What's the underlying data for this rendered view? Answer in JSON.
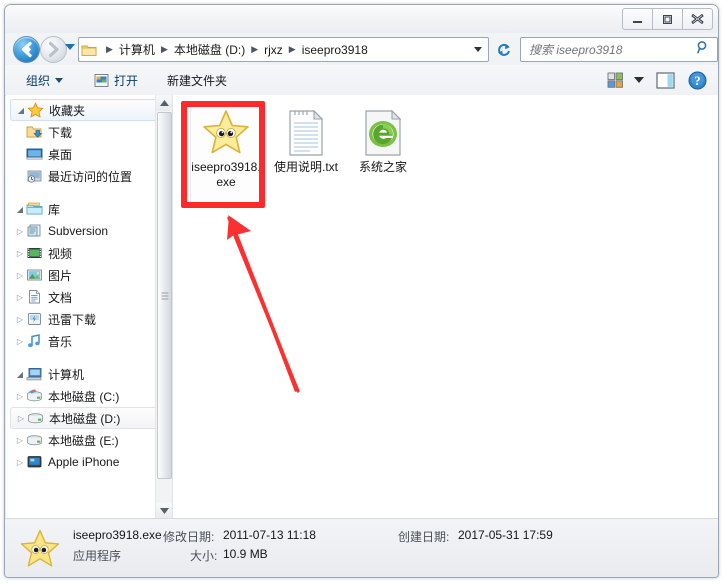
{
  "window": {
    "controls": {
      "minimize": "minimize-button",
      "maximize": "maximize-button",
      "close": "close-button"
    }
  },
  "address": {
    "back_tooltip": "后退",
    "forward_tooltip": "前进",
    "crumbs": [
      "计算机",
      "本地磁盘 (D:)",
      "rjxz",
      "iseepro3918"
    ],
    "separator": "▸"
  },
  "search": {
    "placeholder": "搜索 iseepro3918",
    "value": ""
  },
  "toolbar": {
    "organize": "组织",
    "open": "打开",
    "new_folder": "新建文件夹"
  },
  "sidebar": {
    "groups": [
      {
        "title": "收藏夹",
        "icon": "star-icon",
        "expanded": true,
        "items": [
          {
            "label": "下载",
            "icon": "download-folder-icon",
            "twisty": false
          },
          {
            "label": "桌面",
            "icon": "desktop-icon",
            "twisty": false
          },
          {
            "label": "最近访问的位置",
            "icon": "recent-places-icon",
            "twisty": false
          }
        ]
      },
      {
        "title": "库",
        "icon": "library-icon",
        "expanded": true,
        "items": [
          {
            "label": "Subversion",
            "icon": "subversion-icon",
            "twisty": true
          },
          {
            "label": "视频",
            "icon": "videos-icon",
            "twisty": true
          },
          {
            "label": "图片",
            "icon": "pictures-icon",
            "twisty": true
          },
          {
            "label": "文档",
            "icon": "documents-icon",
            "twisty": true
          },
          {
            "label": "迅雷下载",
            "icon": "thunder-download-icon",
            "twisty": true
          },
          {
            "label": "音乐",
            "icon": "music-icon",
            "twisty": true
          }
        ]
      },
      {
        "title": "计算机",
        "icon": "computer-icon",
        "expanded": true,
        "items": [
          {
            "label": "本地磁盘 (C:)",
            "icon": "system-drive-icon",
            "twisty": true
          },
          {
            "label": "本地磁盘 (D:)",
            "icon": "drive-icon",
            "twisty": true,
            "selected": true
          },
          {
            "label": "本地磁盘 (E:)",
            "icon": "drive-icon",
            "twisty": true
          },
          {
            "label": "Apple iPhone",
            "icon": "iphone-icon",
            "twisty": true
          }
        ]
      }
    ]
  },
  "files": [
    {
      "name": "iseepro3918.exe",
      "icon": "star-app-icon",
      "selected": true,
      "highlighted": true
    },
    {
      "name": "使用说明.txt",
      "icon": "text-file-icon",
      "selected": false,
      "highlighted": false
    },
    {
      "name": "系统之家",
      "icon": "internet-shortcut-icon",
      "selected": false,
      "highlighted": false
    }
  ],
  "status": {
    "file_name": "iseepro3918.exe",
    "file_type": "应用程序",
    "modified_label": "修改日期:",
    "modified_value": "2011-07-13 11:18",
    "created_label": "创建日期:",
    "created_value": "2017-05-31 17:59",
    "size_label": "大小:",
    "size_value": "10.9 MB"
  },
  "annotation": {
    "box_color": "#fb2b2b",
    "arrow_color": "#fb3030"
  }
}
